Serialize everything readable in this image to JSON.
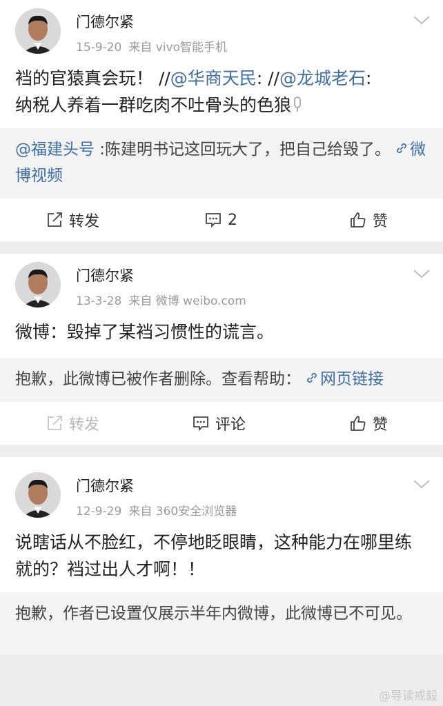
{
  "posts": [
    {
      "author": "门德尔紧",
      "date": "15-9-20",
      "source": "来自 vivo智能手机",
      "text_parts": [
        "裆的官猿真会玩！ //",
        "@华商天民",
        ": //",
        "@龙城老石",
        ":\n纳税人养着一群吃肉不吐骨头的色狼"
      ],
      "repost_parts": [
        "@福建头号",
        " :陈建明书记这回玩大了，把自己给毁了。",
        "微博视频"
      ],
      "actions": {
        "repost": "转发",
        "comment": "2",
        "like": "赞"
      }
    },
    {
      "author": "门德尔紧",
      "date": "13-3-28",
      "source": "来自 微博 weibo.com",
      "text": "微博：毁掉了某裆习惯性的谎言。",
      "repost_parts": [
        "抱歉，此微博已被作者删除。查看帮助：",
        "网页链接"
      ],
      "actions": {
        "repost": "转发",
        "comment": "评论",
        "like": "赞"
      }
    },
    {
      "author": "门德尔紧",
      "date": "12-9-29",
      "source": "来自 360安全浏览器",
      "text": "说瞎话从不脸红，不停地眨眼睛，这种能力在哪里练就的？裆过出人才啊！！",
      "notice": "抱歉，作者已设置仅展示半年内微博，此微博已不可见。"
    }
  ],
  "watermark": "@导读戒毅",
  "colors": {
    "link": "#3e6ea4",
    "meta": "#9a9a9a",
    "bg": "#ededed"
  }
}
